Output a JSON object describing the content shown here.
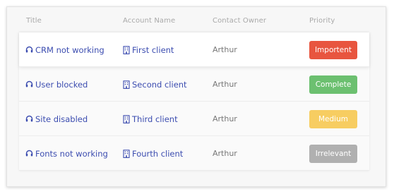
{
  "columns": {
    "title": "Title",
    "account": "Account Name",
    "owner": "Contact Owner",
    "priority": "Priority"
  },
  "rows": [
    {
      "title": "CRM not working",
      "account": "First client",
      "owner": "Arthur",
      "priority": "Importent",
      "priority_color": "#e8553f"
    },
    {
      "title": "User blocked",
      "account": "Second client",
      "owner": "Arthur",
      "priority": "Complete",
      "priority_color": "#6cc070"
    },
    {
      "title": "Site disabled",
      "account": "Third client",
      "owner": "Arthur",
      "priority": "Medium",
      "priority_color": "#f7cd61"
    },
    {
      "title": "Fonts not working",
      "account": "Fourth client",
      "owner": "Arthur",
      "priority": "Irrelevant",
      "priority_color": "#b0b0b0"
    }
  ],
  "icons": {
    "title": "headset-icon",
    "account": "building-icon"
  },
  "colors": {
    "link": "#3c4db0",
    "header_text": "#a9a9a9",
    "owner_text": "#777777"
  }
}
